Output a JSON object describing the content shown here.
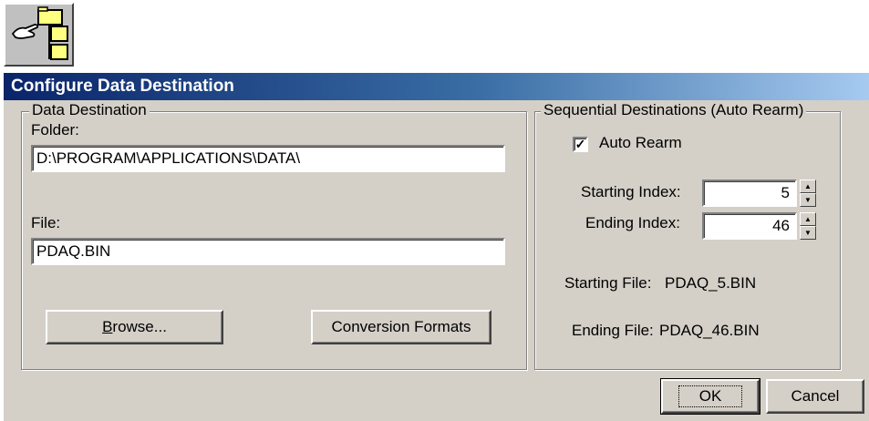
{
  "dialog": {
    "title": "Configure Data Destination"
  },
  "data_destination": {
    "legend": "Data Destination",
    "folder_label": "Folder:",
    "folder_value": "D:\\PROGRAM\\APPLICATIONS\\DATA\\",
    "file_label": "File:",
    "file_value": "PDAQ.BIN",
    "browse_label": "Browse...",
    "browse_mnemonic": "B",
    "browse_rest": "rowse...",
    "conversion_label": "Conversion Formats"
  },
  "sequential": {
    "legend": "Sequential Destinations (Auto Rearm)",
    "auto_rearm_label": "Auto Rearm",
    "auto_rearm_checked": true,
    "auto_rearm_mark": "✓",
    "starting_index_label": "Starting Index:",
    "starting_index_value": "5",
    "ending_index_label": "Ending Index:",
    "ending_index_value": "46",
    "starting_file_label": "Starting File:",
    "starting_file_value": "PDAQ_5.BIN",
    "ending_file_label": "Ending File:",
    "ending_file_value": "PDAQ_46.BIN"
  },
  "buttons": {
    "ok": "OK",
    "cancel": "Cancel"
  },
  "icons": {
    "app": "folder-tree-with-pointing-hand-icon",
    "spin_up": "▲",
    "spin_down": "▼"
  }
}
